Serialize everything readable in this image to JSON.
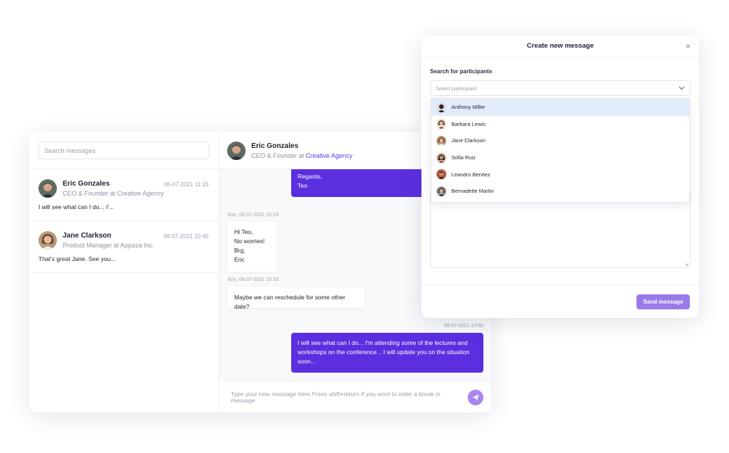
{
  "chat": {
    "search_placeholder": "Search messages",
    "conversations": [
      {
        "name": "Eric Gonzales",
        "role": "CEO & Founder at Creative Agency",
        "date": "06-07-2021 11:15",
        "preview": "I will see what can I do... I'..."
      },
      {
        "name": "Jane Clarkson",
        "role": "Product Manager at Appaza Inc.",
        "date": "06-07-2021 10:45",
        "preview": "That's great Jane. See you..."
      }
    ],
    "thread": {
      "name": "Eric Gonzales",
      "role_prefix": "CEO & Founder at",
      "company": "Creative Agency",
      "messages": [
        {
          "lines": [
            "Regards,",
            "Teo"
          ]
        },
        {
          "meta": "Eric, 05-07-2021 10:19",
          "lines": [
            "Hi Teo,",
            "No worries!",
            "Brg,",
            "Eric"
          ]
        },
        {
          "meta": "Eric, 06-07-2021 10:33",
          "lines": [
            "Maybe we can reschedule for some other date?"
          ]
        },
        {
          "meta": "06-07-2021 10:50",
          "lines": [
            "I will see what can I do... I'm attending some of the lectures and",
            "workshops on the conference... I will update you on the situation",
            "soon..."
          ]
        }
      ]
    },
    "composer_placeholder": "Type your new message here.Press shift+return if you wont to enter a break in message"
  },
  "modal": {
    "title": "Create new message",
    "close_icon": "×",
    "search_label": "Search for participants",
    "select_placeholder": "Select participant",
    "participants": [
      "Anthony Miller",
      "Barbara Lewis",
      "Jane Clarkson",
      "Sofia Ruiz",
      "Leandro Benitez",
      "Bernadette Martin"
    ],
    "send_label": "Send message"
  },
  "colors": {
    "accent": "#5b2fe0",
    "accent_light": "#9a7ae8",
    "highlight": "#e3ecfb"
  }
}
